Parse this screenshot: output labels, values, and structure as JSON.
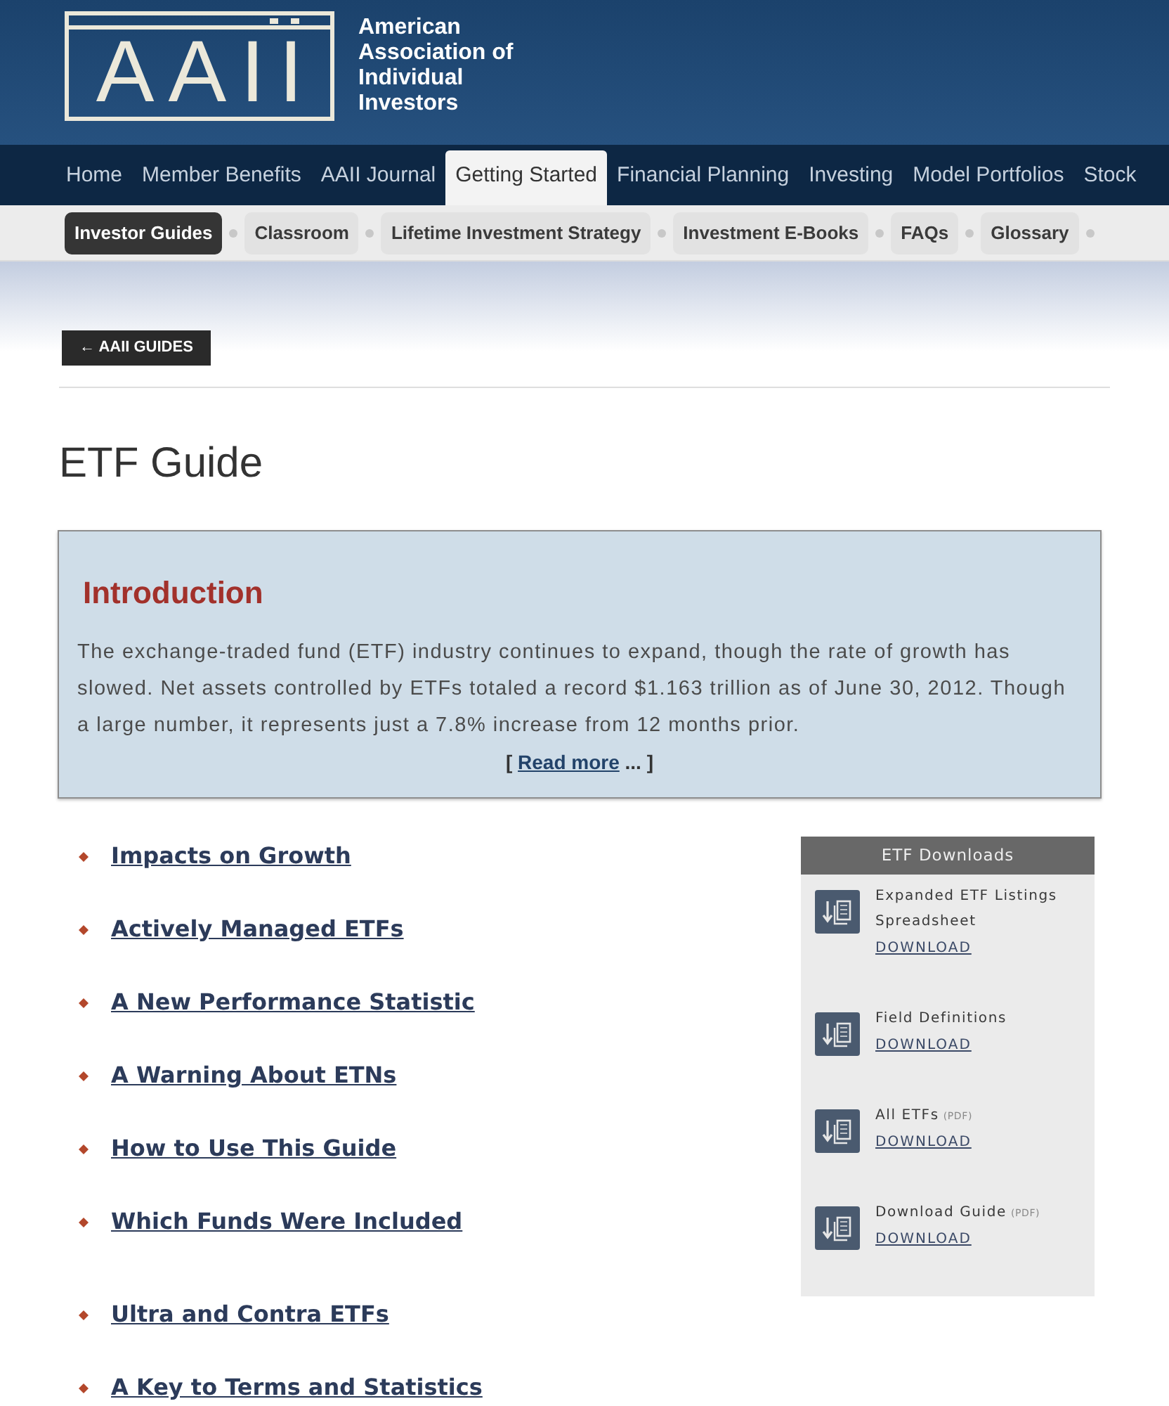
{
  "header": {
    "logo": "AAII",
    "organization": "American Association of Individual Investors"
  },
  "main_nav": [
    {
      "label": "Home",
      "selected": false
    },
    {
      "label": "Member Benefits",
      "selected": false
    },
    {
      "label": "AAII Journal",
      "selected": false
    },
    {
      "label": "Getting Started",
      "selected": true
    },
    {
      "label": "Financial Planning",
      "selected": false
    },
    {
      "label": "Investing",
      "selected": false
    },
    {
      "label": "Model Portfolios",
      "selected": false
    },
    {
      "label": "Stock",
      "selected": false
    }
  ],
  "sub_nav": [
    {
      "label": "Investor Guides",
      "selected": true
    },
    {
      "label": "Classroom",
      "selected": false
    },
    {
      "label": "Lifetime Investment Strategy",
      "selected": false
    },
    {
      "label": "Investment E-Books",
      "selected": false
    },
    {
      "label": "FAQs",
      "selected": false
    },
    {
      "label": "Glossary",
      "selected": false
    }
  ],
  "back_button": "← AAII GUIDES",
  "page_title": "ETF Guide",
  "intro": {
    "heading": "Introduction",
    "text": "The exchange-traded fund (ETF) industry continues to expand, though the rate of growth has slowed. Net assets controlled by ETFs totaled a record $1.163 trillion as of June 30, 2012. Though a large number, it represents just a 7.8% increase from 12 months prior.",
    "read_more": {
      "open": "[",
      "link": "Read more",
      "close": "... ]"
    }
  },
  "topic_groups": [
    {
      "items": [
        "Impacts on Growth",
        "Actively Managed ETFs",
        "A New Performance Statistic",
        "A Warning About ETNs",
        "How to Use This Guide",
        "Which Funds Were Included"
      ]
    },
    {
      "items": [
        "Ultra and Contra ETFs",
        "A Key to Terms and Statistics"
      ]
    }
  ],
  "downloads": {
    "title": "ETF Downloads",
    "items": [
      {
        "name": "Expanded ETF Listings Spreadsheet",
        "link": "DOWNLOAD"
      },
      {
        "name": "Field Definitions",
        "link": "DOWNLOAD"
      },
      {
        "name": "All ETFs",
        "tag": "(PDF)",
        "link": "DOWNLOAD"
      },
      {
        "name": "Download Guide",
        "tag": "(PDF)",
        "link": "DOWNLOAD"
      }
    ]
  }
}
